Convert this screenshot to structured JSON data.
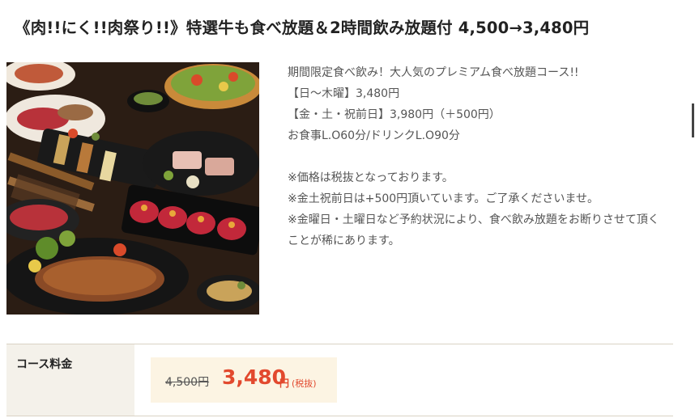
{
  "course": {
    "title": "《肉!!にく!!肉祭り!!》特選牛も食べ放題＆2時間飲み放題付 4,500→3,480円",
    "description_lines": [
      "期間限定食べ飲み！大人気のプレミアム食べ放題コース!!",
      "【日～木曜】3,480円",
      "【金・土・祝前日】3,980円（＋500円）",
      "お食事L.O60分/ドリンクL.O90分"
    ],
    "notes": [
      "※価格は税抜となっております。",
      "※金土祝前日は+500円頂いています。ご了承くださいませ。",
      "※金曜日・土曜日など予約状況により、食べ飲み放題をお断りさせて頂くことが稀にあります。"
    ]
  },
  "price": {
    "label": "コース料金",
    "old_price": "4,500円",
    "new_price": "3,480",
    "unit": "円",
    "tax_note": "(税抜)"
  },
  "colors": {
    "price_accent": "#e2492e",
    "price_box_bg": "#fcf4e3",
    "label_cell_bg": "#f4f1ea"
  }
}
